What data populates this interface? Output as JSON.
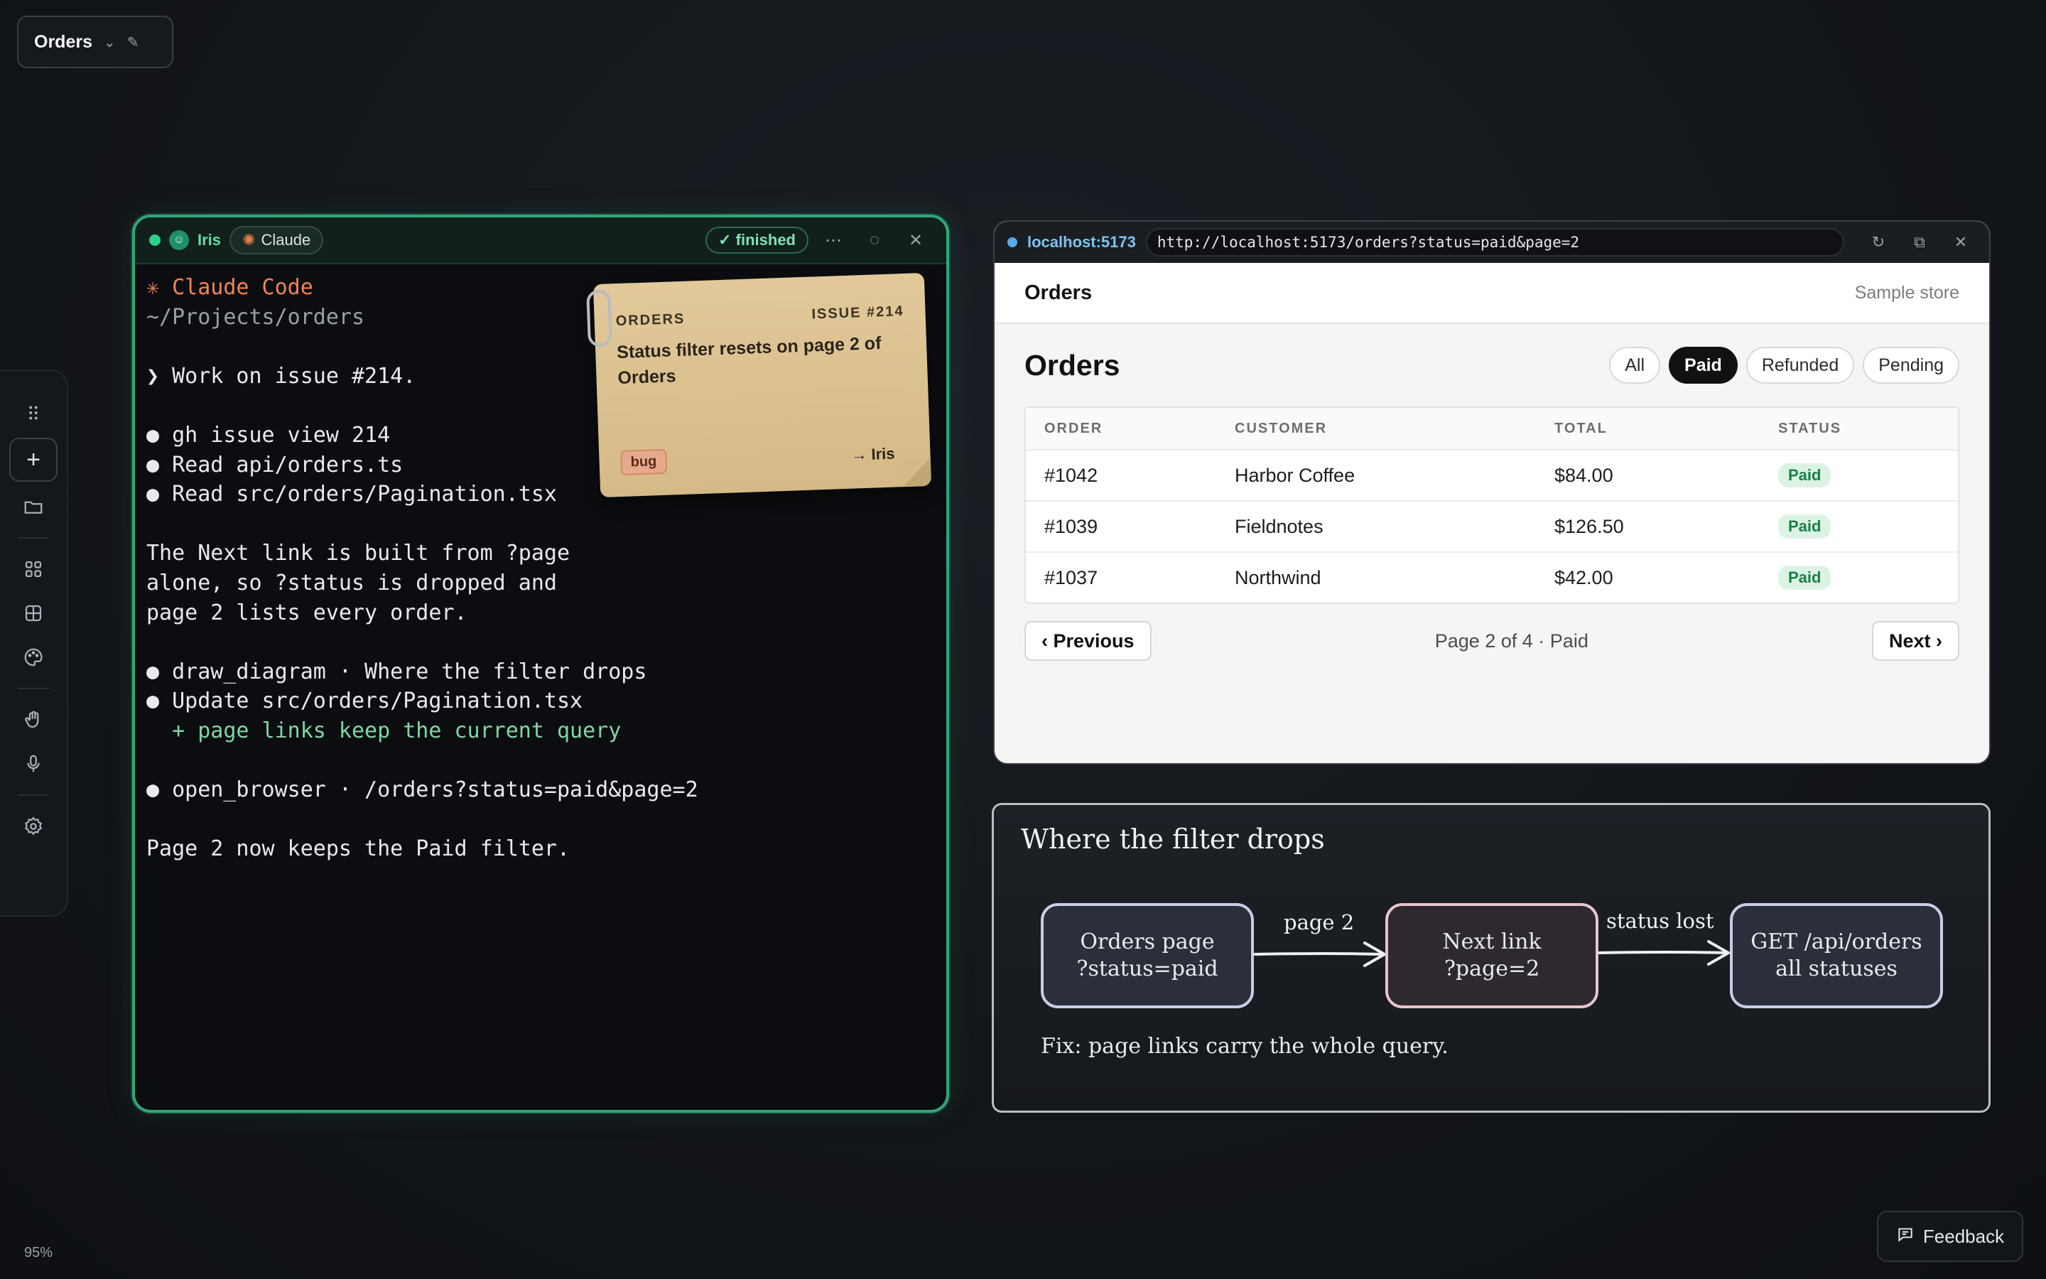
{
  "workspace": {
    "title": "Orders"
  },
  "toolbar": {
    "items": [
      "grip-icon",
      "add-icon",
      "folder-icon",
      "apps-icon",
      "grid-icon",
      "palette-icon",
      "hand-icon",
      "mic-icon",
      "settings-icon"
    ]
  },
  "zoom": "95%",
  "feedback_label": "Feedback",
  "terminal": {
    "agent_name": "Iris",
    "model_chip": "Claude",
    "status": "✓ finished",
    "lines": [
      {
        "text": "✳ Claude Code",
        "style": "orange"
      },
      {
        "text": "~/Projects/orders",
        "style": "dim"
      },
      {
        "text": "",
        "style": ""
      },
      {
        "text": "❯ Work on issue #214.",
        "style": ""
      },
      {
        "text": "",
        "style": ""
      },
      {
        "text": "● gh issue view 214",
        "style": ""
      },
      {
        "text": "● Read api/orders.ts",
        "style": ""
      },
      {
        "text": "● Read src/orders/Pagination.tsx",
        "style": ""
      },
      {
        "text": "",
        "style": ""
      },
      {
        "text": "The Next link is built from ?page",
        "style": ""
      },
      {
        "text": "alone, so ?status is dropped and",
        "style": ""
      },
      {
        "text": "page 2 lists every order.",
        "style": ""
      },
      {
        "text": "",
        "style": ""
      },
      {
        "text": "● draw_diagram · Where the filter drops",
        "style": ""
      },
      {
        "text": "● Update src/orders/Pagination.tsx",
        "style": ""
      },
      {
        "text": "  + page links keep the current query",
        "style": "green"
      },
      {
        "text": "",
        "style": ""
      },
      {
        "text": "● open_browser · /orders?status=paid&page=2",
        "style": ""
      },
      {
        "text": "",
        "style": ""
      },
      {
        "text": "Page 2 now keeps the Paid filter.",
        "style": ""
      }
    ]
  },
  "sticky": {
    "project": "ORDERS",
    "issue": "ISSUE #214",
    "title": "Status filter resets on page 2 of Orders",
    "label": "bug",
    "assignee": "→ Iris"
  },
  "browser": {
    "host": "localhost:5173",
    "url": "http://localhost:5173/orders?status=paid&page=2",
    "app_brand": "Orders",
    "store_name": "Sample store",
    "page_title": "Orders",
    "filters": [
      {
        "label": "All",
        "active": false
      },
      {
        "label": "Paid",
        "active": true
      },
      {
        "label": "Refunded",
        "active": false
      },
      {
        "label": "Pending",
        "active": false
      }
    ],
    "columns": [
      "ORDER",
      "CUSTOMER",
      "TOTAL",
      "STATUS"
    ],
    "rows": [
      {
        "order": "#1042",
        "customer": "Harbor Coffee",
        "total": "$84.00",
        "status": "Paid"
      },
      {
        "order": "#1039",
        "customer": "Fieldnotes",
        "total": "$126.50",
        "status": "Paid"
      },
      {
        "order": "#1037",
        "customer": "Northwind",
        "total": "$42.00",
        "status": "Paid"
      }
    ],
    "prev_label": "‹ Previous",
    "page_info": "Page 2 of 4 · Paid",
    "next_label": "Next ›"
  },
  "diagram": {
    "title": "Where the filter drops",
    "nodes": [
      {
        "line1": "Orders page",
        "line2": "?status=paid"
      },
      {
        "line1": "Next link",
        "line2": "?page=2"
      },
      {
        "line1": "GET /api/orders",
        "line2": "all statuses"
      }
    ],
    "edges": [
      "page 2",
      "status lost"
    ],
    "fix": "Fix: page links carry the whole query."
  }
}
